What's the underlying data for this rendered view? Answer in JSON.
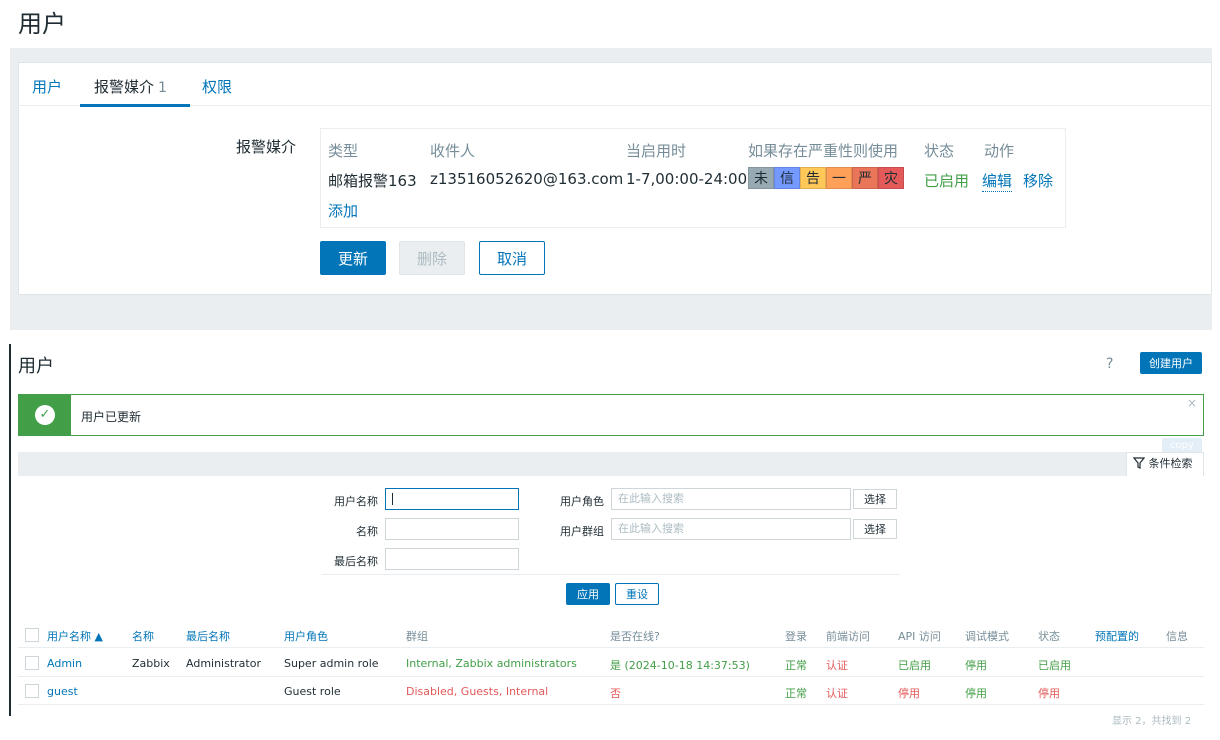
{
  "top": {
    "title": "用户",
    "tabs": [
      {
        "label": "用户"
      },
      {
        "label": "报警媒介",
        "count": "1"
      },
      {
        "label": "权限"
      }
    ],
    "media": {
      "label": "报警媒介",
      "headers": [
        "类型",
        "收件人",
        "当启用时",
        "如果存在严重性则使用",
        "状态",
        "动作"
      ],
      "row": {
        "type": "邮箱报警163",
        "recipient": "z13516052620@163.com",
        "when_active": "1-7,00:00-24:00",
        "severities": [
          {
            "label": "未",
            "color": "#97aab3"
          },
          {
            "label": "信",
            "color": "#7499ff"
          },
          {
            "label": "告",
            "color": "#ffc859"
          },
          {
            "label": "一",
            "color": "#ffa059"
          },
          {
            "label": "严",
            "color": "#e97659"
          },
          {
            "label": "灾",
            "color": "#e45959"
          }
        ],
        "status": "已启用",
        "edit": "编辑",
        "remove": "移除"
      },
      "add": "添加"
    },
    "buttons": {
      "update": "更新",
      "delete": "删除",
      "cancel": "取消"
    }
  },
  "lower": {
    "title": "用户",
    "help": "?",
    "create_button": "创建用户",
    "message": "用户已更新",
    "close": "×",
    "copy": "copy",
    "filter": {
      "tab_label": "条件检索",
      "username_label": "用户名称",
      "name_label": "名称",
      "lastname_label": "最后名称",
      "role_label": "用户角色",
      "role_placeholder": "在此输入搜索",
      "group_label": "用户群组",
      "group_placeholder": "在此输入搜索",
      "select": "选择",
      "apply": "应用",
      "reset": "重设"
    },
    "table": {
      "headers": [
        "用户名称 ▲",
        "名称",
        "最后名称",
        "用户角色",
        "群组",
        "是否在线?",
        "登录",
        "前端访问",
        "API 访问",
        "调试模式",
        "状态",
        "预配置的",
        "信息"
      ],
      "rows": [
        {
          "username": "Admin",
          "name": "Zabbix",
          "lastname": "Administrator",
          "role": "Super admin role",
          "groups": "Internal, Zabbix administrators",
          "online": "是 (2024-10-18 14:37:53)",
          "login": "正常",
          "frontend": "认证",
          "api": "已启用",
          "debug": "停用",
          "status": "已启用"
        },
        {
          "username": "guest",
          "name": "",
          "lastname": "",
          "role": "Guest role",
          "groups_disabled": "Disabled",
          "groups_rest": ", Guests, Internal",
          "online": "否",
          "login": "正常",
          "frontend": "认证",
          "api": "停用",
          "debug": "停用",
          "status": "停用"
        }
      ],
      "footer": "显示 2，共找到 2"
    }
  }
}
